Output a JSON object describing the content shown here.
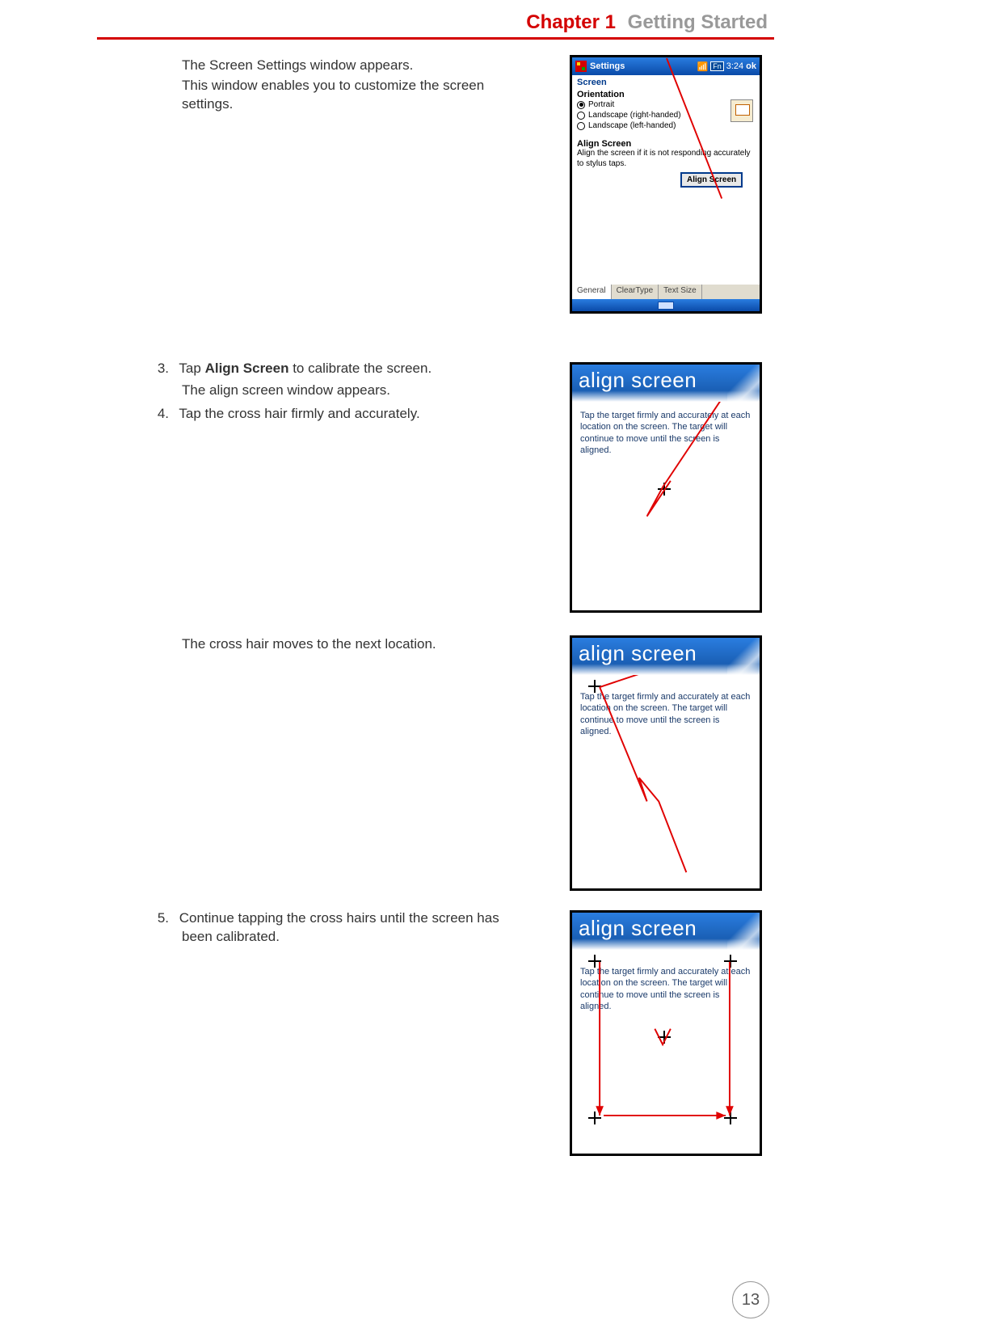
{
  "header": {
    "chapter": "Chapter 1",
    "title": "Getting Started"
  },
  "page_number": "13",
  "intro": {
    "line1": "The Screen Settings window appears.",
    "line2": "This window enables you to customize the screen settings."
  },
  "steps": {
    "s3_prefix": "3.",
    "s3a": "Tap ",
    "s3_bold": "Align Screen",
    "s3b": " to calibrate the screen.",
    "s3_sub": "The align screen window appears.",
    "s4_prefix": "4.",
    "s4": "Tap the cross hair firmly and accurately.",
    "mid": "The cross hair moves to the next location.",
    "s5_prefix": "5.",
    "s5": "Continue tapping the cross hairs until the screen has been calibrated."
  },
  "settings_panel": {
    "title": "Settings",
    "time": "3:24",
    "fn": "Fn",
    "ok": "ok",
    "screen_label": "Screen",
    "orientation_label": "Orientation",
    "opt_portrait": "Portrait",
    "opt_land_r": "Landscape (right-handed)",
    "opt_land_l": "Landscape (left-handed)",
    "align_label": "Align Screen",
    "align_desc": "Align the screen if it is not responding accurately to stylus taps.",
    "align_btn": "Align Screen",
    "tab_general": "General",
    "tab_cleartype": "ClearType",
    "tab_textsize": "Text Size"
  },
  "align_panel": {
    "title": "align screen",
    "body": "Tap the target firmly and accurately at each location on the screen. The target will continue to move until the screen is aligned."
  }
}
